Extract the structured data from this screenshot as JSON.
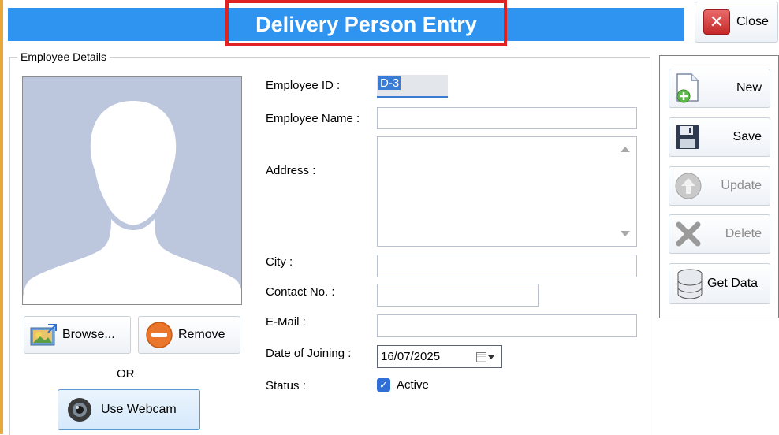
{
  "window": {
    "title": "Delivery Person Entry",
    "close_label": "Close"
  },
  "group": {
    "label": "Employee Details"
  },
  "photo": {
    "browse_label": "Browse...",
    "remove_label": "Remove",
    "or_label": "OR",
    "webcam_label": "Use Webcam"
  },
  "form": {
    "employee_id": {
      "label": "Employee ID :",
      "value": "D-3"
    },
    "employee_name": {
      "label": "Employee Name :",
      "value": ""
    },
    "address": {
      "label": "Address :",
      "value": ""
    },
    "city": {
      "label": "City :",
      "value": ""
    },
    "contact": {
      "label": "Contact No. :",
      "value": ""
    },
    "email": {
      "label": "E-Mail :",
      "value": ""
    },
    "date_of_joining": {
      "label": "Date of Joining :",
      "value": "16/07/2025"
    },
    "status": {
      "label": "Status :",
      "checkbox_label": "Active",
      "checked": true
    }
  },
  "actions": {
    "new": "New",
    "save": "Save",
    "update": "Update",
    "delete": "Delete",
    "get_data": "Get Data"
  },
  "colors": {
    "title_bar": "#2f93f0",
    "highlight": "#e02222",
    "accent": "#e8a93a"
  }
}
